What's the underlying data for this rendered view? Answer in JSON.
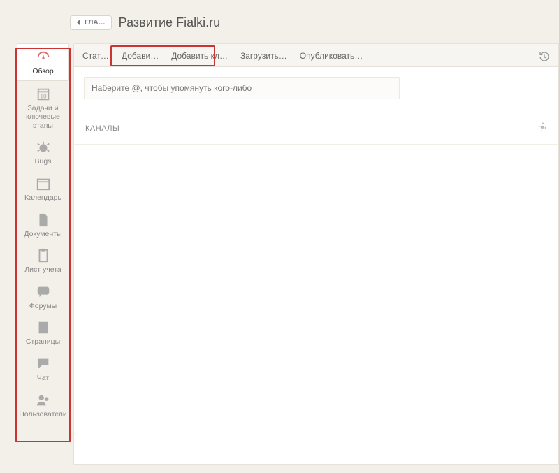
{
  "header": {
    "back_label": "ГЛА…",
    "page_title": "Развитие Fialki.ru"
  },
  "sidebar": {
    "items": [
      {
        "label": "Обзор",
        "icon": "gauge-icon",
        "active": true
      },
      {
        "label": "Задачи и ключевые этапы",
        "icon": "calendar-todo-icon"
      },
      {
        "label": "Bugs",
        "icon": "bug-icon"
      },
      {
        "label": "Календарь",
        "icon": "calendar-icon"
      },
      {
        "label": "Документы",
        "icon": "document-icon"
      },
      {
        "label": "Лист учета",
        "icon": "clipboard-icon"
      },
      {
        "label": "Форумы",
        "icon": "chat-bubble-icon"
      },
      {
        "label": "Страницы",
        "icon": "doc-square-icon"
      },
      {
        "label": "Чат",
        "icon": "speech-icon"
      },
      {
        "label": "Пользователи",
        "icon": "users-icon"
      }
    ]
  },
  "tabs": {
    "items": [
      {
        "label": "Стат…"
      },
      {
        "label": "Добави…"
      },
      {
        "label": "Добавить кл…"
      },
      {
        "label": "Загрузить…"
      },
      {
        "label": "Опубликовать…"
      }
    ]
  },
  "compose": {
    "placeholder": "Наберите @, чтобы упомянуть кого-либо"
  },
  "channels": {
    "title": "КАНАЛЫ"
  }
}
